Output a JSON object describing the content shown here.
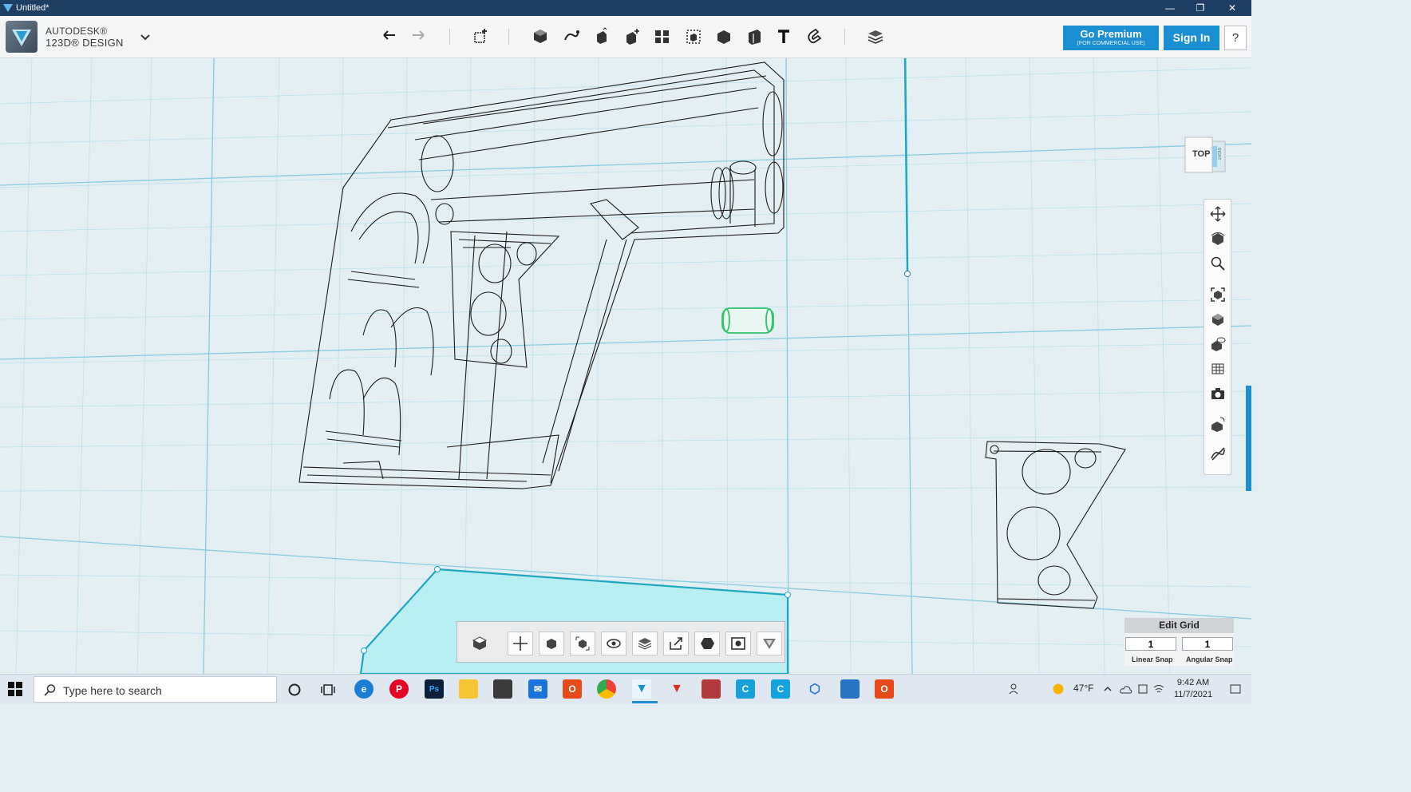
{
  "window": {
    "title": "Untitled*",
    "minimize": "—",
    "restore": "❐",
    "close": "✕"
  },
  "app": {
    "brand": "AUTODESK®",
    "product": "123D® DESIGN"
  },
  "toolbar": {
    "tools": [
      "undo",
      "redo",
      "transform",
      "primitives",
      "sketch",
      "construct",
      "modify",
      "pattern",
      "grouping",
      "combine",
      "measure",
      "text",
      "snap",
      "material"
    ]
  },
  "header": {
    "premium_label": "Go Premium",
    "premium_sublabel": "(FOR COMMERCIAL USE)",
    "signin_label": "Sign In",
    "help_label": "?"
  },
  "viewcube": {
    "face_label": "TOP",
    "side_label": "RIGHT"
  },
  "navbar": {
    "tools": [
      "pan",
      "orbit",
      "zoom",
      "fit",
      "views",
      "visibility",
      "materials-and-outlines",
      "screenshot",
      "snap-view",
      "hide-sketch"
    ]
  },
  "bottombar": {
    "tools": [
      "viewcube-toggle",
      "pan",
      "orbit-object",
      "zoom-fit",
      "visibility",
      "layers",
      "export",
      "solid",
      "screenshot",
      "logo"
    ]
  },
  "edit_grid": {
    "title": "Edit Grid",
    "linear_snap_value": "1",
    "angular_snap_value": "1",
    "linear_snap_label": "Linear Snap",
    "angular_snap_label": "Angular Snap"
  },
  "taskbar": {
    "search_placeholder": "Type here to search",
    "apps": [
      "task-view",
      "widgets",
      "edge",
      "pinterest",
      "photoshop",
      "file-explorer",
      "store",
      "mail",
      "office",
      "chrome",
      "123d-design",
      "autodesk-app",
      "3d-app",
      "c-app-1",
      "c-app-2",
      "3d-viewer",
      "photos",
      "office-2"
    ],
    "weather": "47°F",
    "time": "9:42 AM",
    "date": "11/7/2021"
  },
  "colors": {
    "accent": "#1a8fd1",
    "titlebar": "#1e3f63",
    "grid_major": "#85cce1",
    "selection": "#31c46b"
  }
}
